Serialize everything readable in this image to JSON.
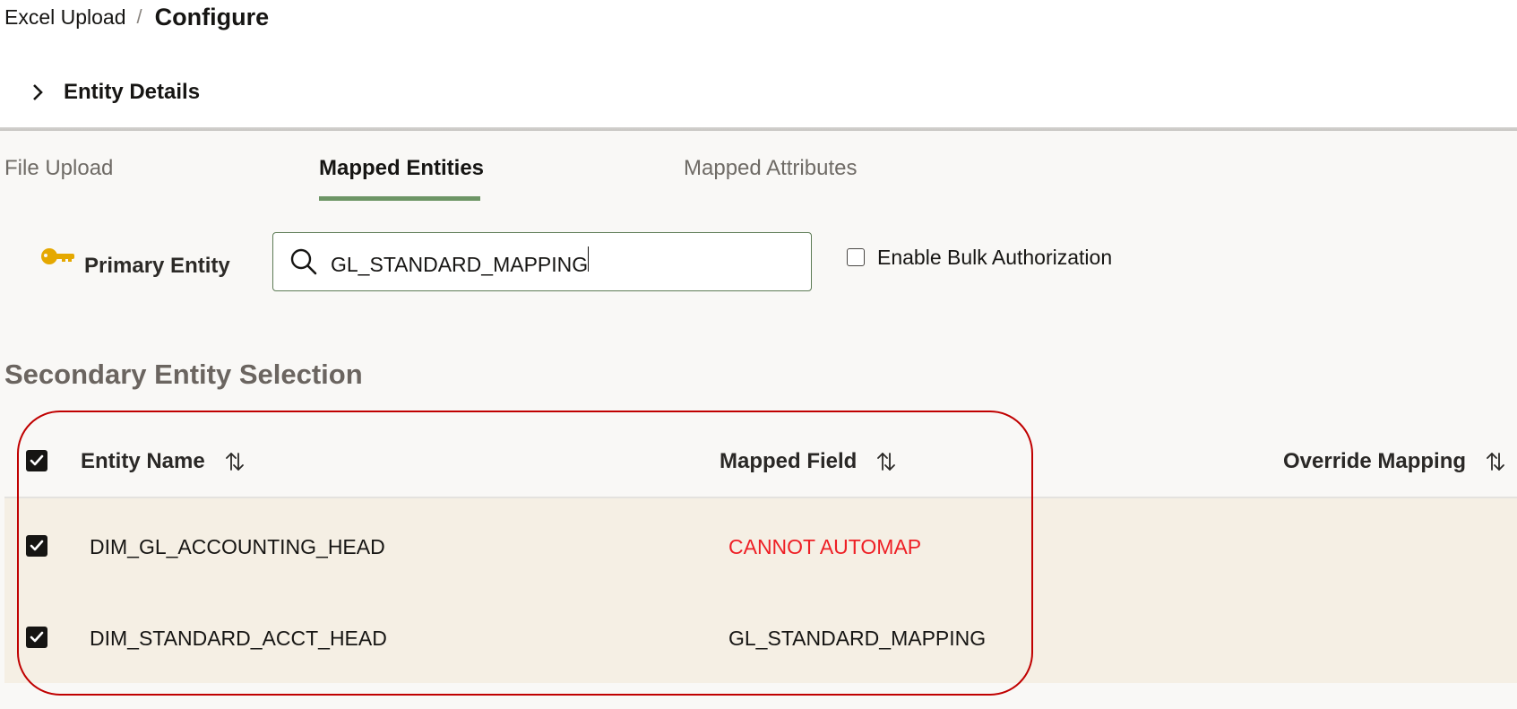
{
  "breadcrumb": {
    "parent": "Excel Upload",
    "separator": "/",
    "current": "Configure"
  },
  "entity_details": {
    "label": "Entity Details",
    "expanded": false,
    "icon": "chevron-right-icon"
  },
  "tabs": [
    {
      "label": "File Upload",
      "active": false
    },
    {
      "label": "Mapped Entities",
      "active": true
    },
    {
      "label": "Mapped Attributes",
      "active": false
    }
  ],
  "primary_entity": {
    "icon": "key-icon",
    "label": "Primary Entity",
    "search_value": "GL_STANDARD_MAPPING",
    "search_icon": "search-icon"
  },
  "bulk_authorization": {
    "label": "Enable Bulk Authorization",
    "checked": false
  },
  "secondary": {
    "title": "Secondary Entity Selection",
    "select_all_checked": true,
    "columns": [
      {
        "label": "Entity Name",
        "sortable": true
      },
      {
        "label": "Mapped Field",
        "sortable": true
      },
      {
        "label": "Override Mapping",
        "sortable": true
      }
    ],
    "rows": [
      {
        "checked": true,
        "entity_name": "DIM_GL_ACCOUNTING_HEAD",
        "mapped_field": "CANNOT AUTOMAP",
        "mapped_field_status": "error",
        "override_mapping": ""
      },
      {
        "checked": true,
        "entity_name": "DIM_STANDARD_ACCT_HEAD",
        "mapped_field": "GL_STANDARD_MAPPING",
        "mapped_field_status": "ok",
        "override_mapping": ""
      }
    ]
  },
  "colors": {
    "active_tab_underline": "#6d9565",
    "error_text": "#ee1f25",
    "key_icon": "#e5a800",
    "highlight_border": "#c00000",
    "row_band": "#f5efe4"
  }
}
